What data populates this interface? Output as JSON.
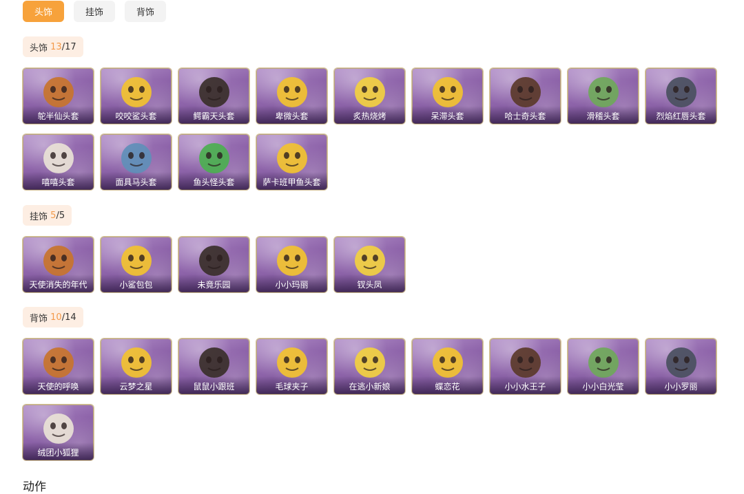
{
  "tabs": [
    {
      "label": "头饰",
      "active": true
    },
    {
      "label": "挂饰",
      "active": false
    },
    {
      "label": "背饰",
      "active": false
    }
  ],
  "sections": {
    "head": {
      "title": "头饰",
      "owned": "13",
      "total": "/17",
      "items": [
        "鸵半仙头套",
        "咬咬鲨头套",
        "鳄霸天头套",
        "卑微头套",
        "炙热烧烤",
        "呆滞头套",
        "哈士奇头套",
        "滑稽头套",
        "烈焰红唇头套",
        "嘻嘻头套",
        "面具马头套",
        "鱼头怪头套",
        "萨卡班甲鱼头套"
      ]
    },
    "hang": {
      "title": "挂饰",
      "owned": "5",
      "total": "/5",
      "items": [
        "天使消失的年代",
        "小鲨包包",
        "未竟乐园",
        "小小玛丽",
        "钗头凤"
      ]
    },
    "back": {
      "title": "背饰",
      "owned": "10",
      "total": "/14",
      "items": [
        "天使的呼唤",
        "云梦之星",
        "鼠鼠小跟班",
        "毛球夹子",
        "在逃小新娘",
        "蝶恋花",
        "小小水王子",
        "小小白光莹",
        "小小罗丽",
        "绒团小狐狸"
      ]
    }
  },
  "footer": {
    "title": "动作"
  }
}
